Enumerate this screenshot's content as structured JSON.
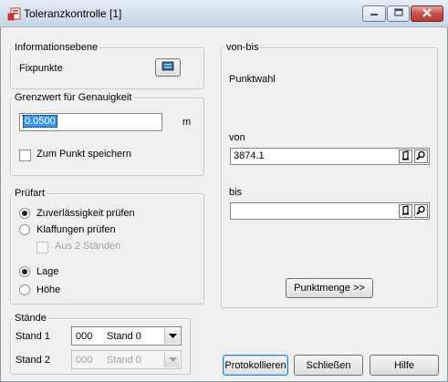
{
  "window": {
    "title": "Toleranzkontrolle [1]",
    "icon": "app-document-icon",
    "controls": [
      "minimize-icon",
      "maximize-icon",
      "close-icon"
    ]
  },
  "info": {
    "legend": "Informationsebene",
    "value": "Fixpunkte",
    "button_icon": "layer-picker-icon"
  },
  "grenzwert": {
    "legend": "Grenzwert für Genauigkeit",
    "value": "0.0500",
    "unit": "m",
    "save_label": "Zum Punkt speichern",
    "save_checked": false
  },
  "pruefart": {
    "legend": "Prüfart",
    "options": [
      {
        "label": "Zuverlässigkeit prüfen",
        "selected": true
      },
      {
        "label": "Klaffungen prüfen",
        "selected": false
      }
    ],
    "sub_option": {
      "label": "Aus 2 Ständen",
      "checked": false,
      "enabled": false
    },
    "dimension": [
      {
        "label": "Lage",
        "selected": true
      },
      {
        "label": "Höhe",
        "selected": false
      }
    ]
  },
  "staende": {
    "legend": "Stände",
    "stand1": {
      "label": "Stand 1",
      "code": "000",
      "name": "Stand 0"
    },
    "stand2": {
      "label": "Stand 2",
      "code": "000",
      "name": "Stand 0"
    }
  },
  "vonbis": {
    "legend": "von-bis",
    "heading": "Punktwahl",
    "von_label": "von",
    "von_value": "3874.1",
    "bis_label": "bis",
    "bis_value": "",
    "punktmenge_label": "Punktmenge >>"
  },
  "buttons": {
    "protokollieren": "Protokollieren",
    "schliessen": "Schließen",
    "hilfe": "Hilfe"
  }
}
